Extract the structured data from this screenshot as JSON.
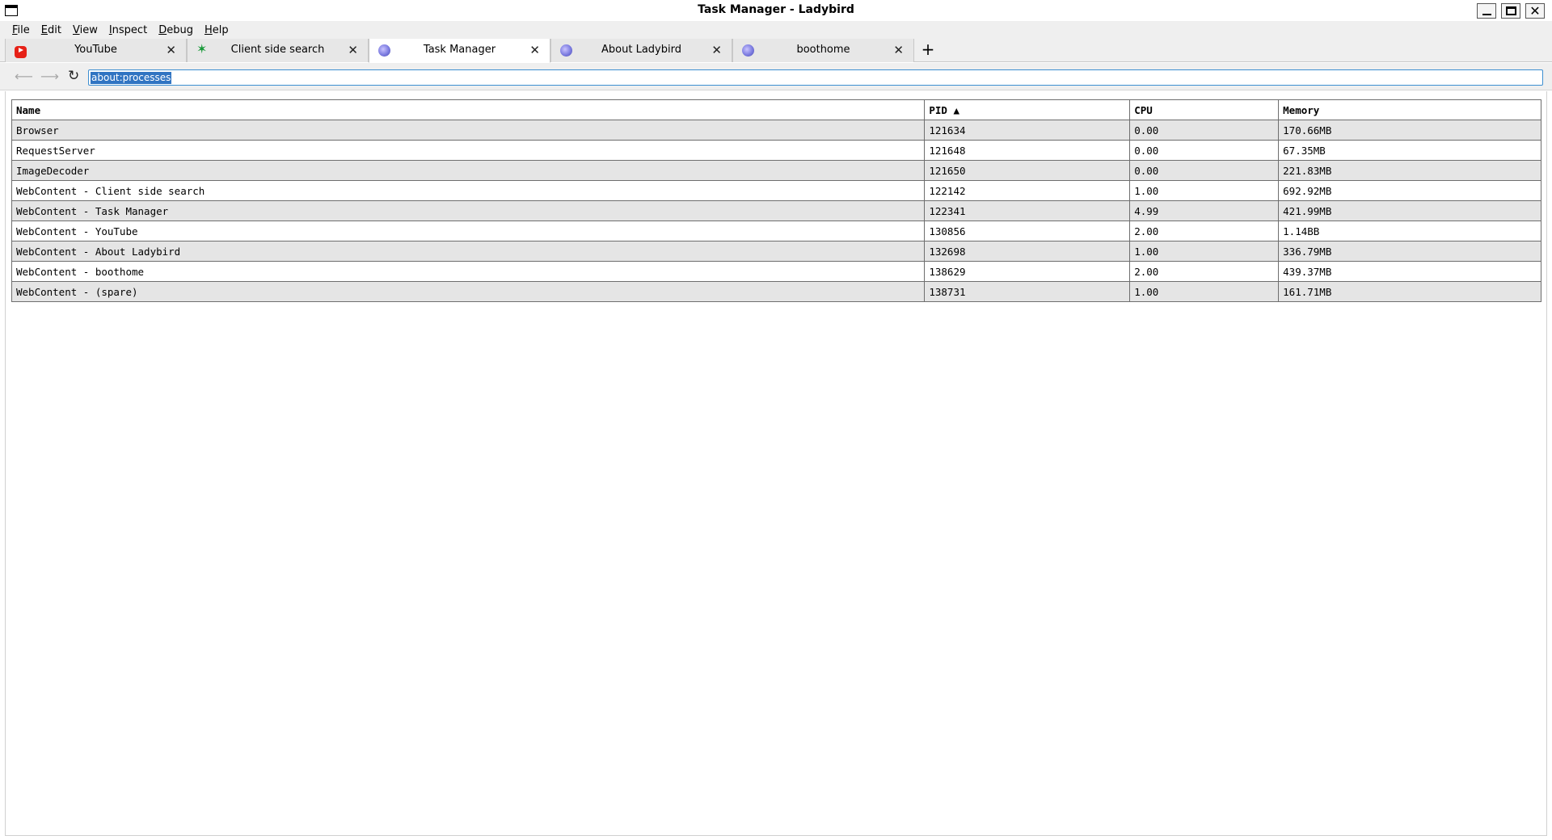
{
  "window": {
    "title": "Task Manager - Ladybird"
  },
  "menu": [
    {
      "label": "File",
      "underline": "F",
      "rest": "ile"
    },
    {
      "label": "Edit",
      "underline": "E",
      "rest": "dit"
    },
    {
      "label": "View",
      "underline": "V",
      "rest": "iew"
    },
    {
      "label": "Inspect",
      "underline": "I",
      "rest": "nspect"
    },
    {
      "label": "Debug",
      "underline": "D",
      "rest": "ebug"
    },
    {
      "label": "Help",
      "underline": "H",
      "rest": "elp"
    }
  ],
  "tabs": [
    {
      "label": "YouTube",
      "icon": "youtube-icon",
      "active": false
    },
    {
      "label": "Client side search",
      "icon": "star-icon",
      "active": false
    },
    {
      "label": "Task Manager",
      "icon": "ladybird-icon",
      "active": true
    },
    {
      "label": "About Ladybird",
      "icon": "ladybird-icon",
      "active": false
    },
    {
      "label": "boothome",
      "icon": "ladybird-icon",
      "active": false
    }
  ],
  "nav": {
    "url": "about:processes"
  },
  "table": {
    "headers": {
      "name": "Name",
      "pid": "PID ▲",
      "cpu": "CPU",
      "memory": "Memory"
    },
    "rows": [
      {
        "name": "Browser",
        "pid": "121634",
        "cpu": "0.00",
        "memory": "170.66MB"
      },
      {
        "name": "RequestServer",
        "pid": "121648",
        "cpu": "0.00",
        "memory": "67.35MB"
      },
      {
        "name": "ImageDecoder",
        "pid": "121650",
        "cpu": "0.00",
        "memory": "221.83MB"
      },
      {
        "name": "WebContent - Client side search",
        "pid": "122142",
        "cpu": "1.00",
        "memory": "692.92MB"
      },
      {
        "name": "WebContent - Task Manager",
        "pid": "122341",
        "cpu": "4.99",
        "memory": "421.99MB"
      },
      {
        "name": "WebContent - YouTube",
        "pid": "130856",
        "cpu": "2.00",
        "memory": "1.14BB"
      },
      {
        "name": "WebContent - About Ladybird",
        "pid": "132698",
        "cpu": "1.00",
        "memory": "336.79MB"
      },
      {
        "name": "WebContent - boothome",
        "pid": "138629",
        "cpu": "2.00",
        "memory": "439.37MB"
      },
      {
        "name": "WebContent - (spare)",
        "pid": "138731",
        "cpu": "1.00",
        "memory": "161.71MB"
      }
    ]
  }
}
